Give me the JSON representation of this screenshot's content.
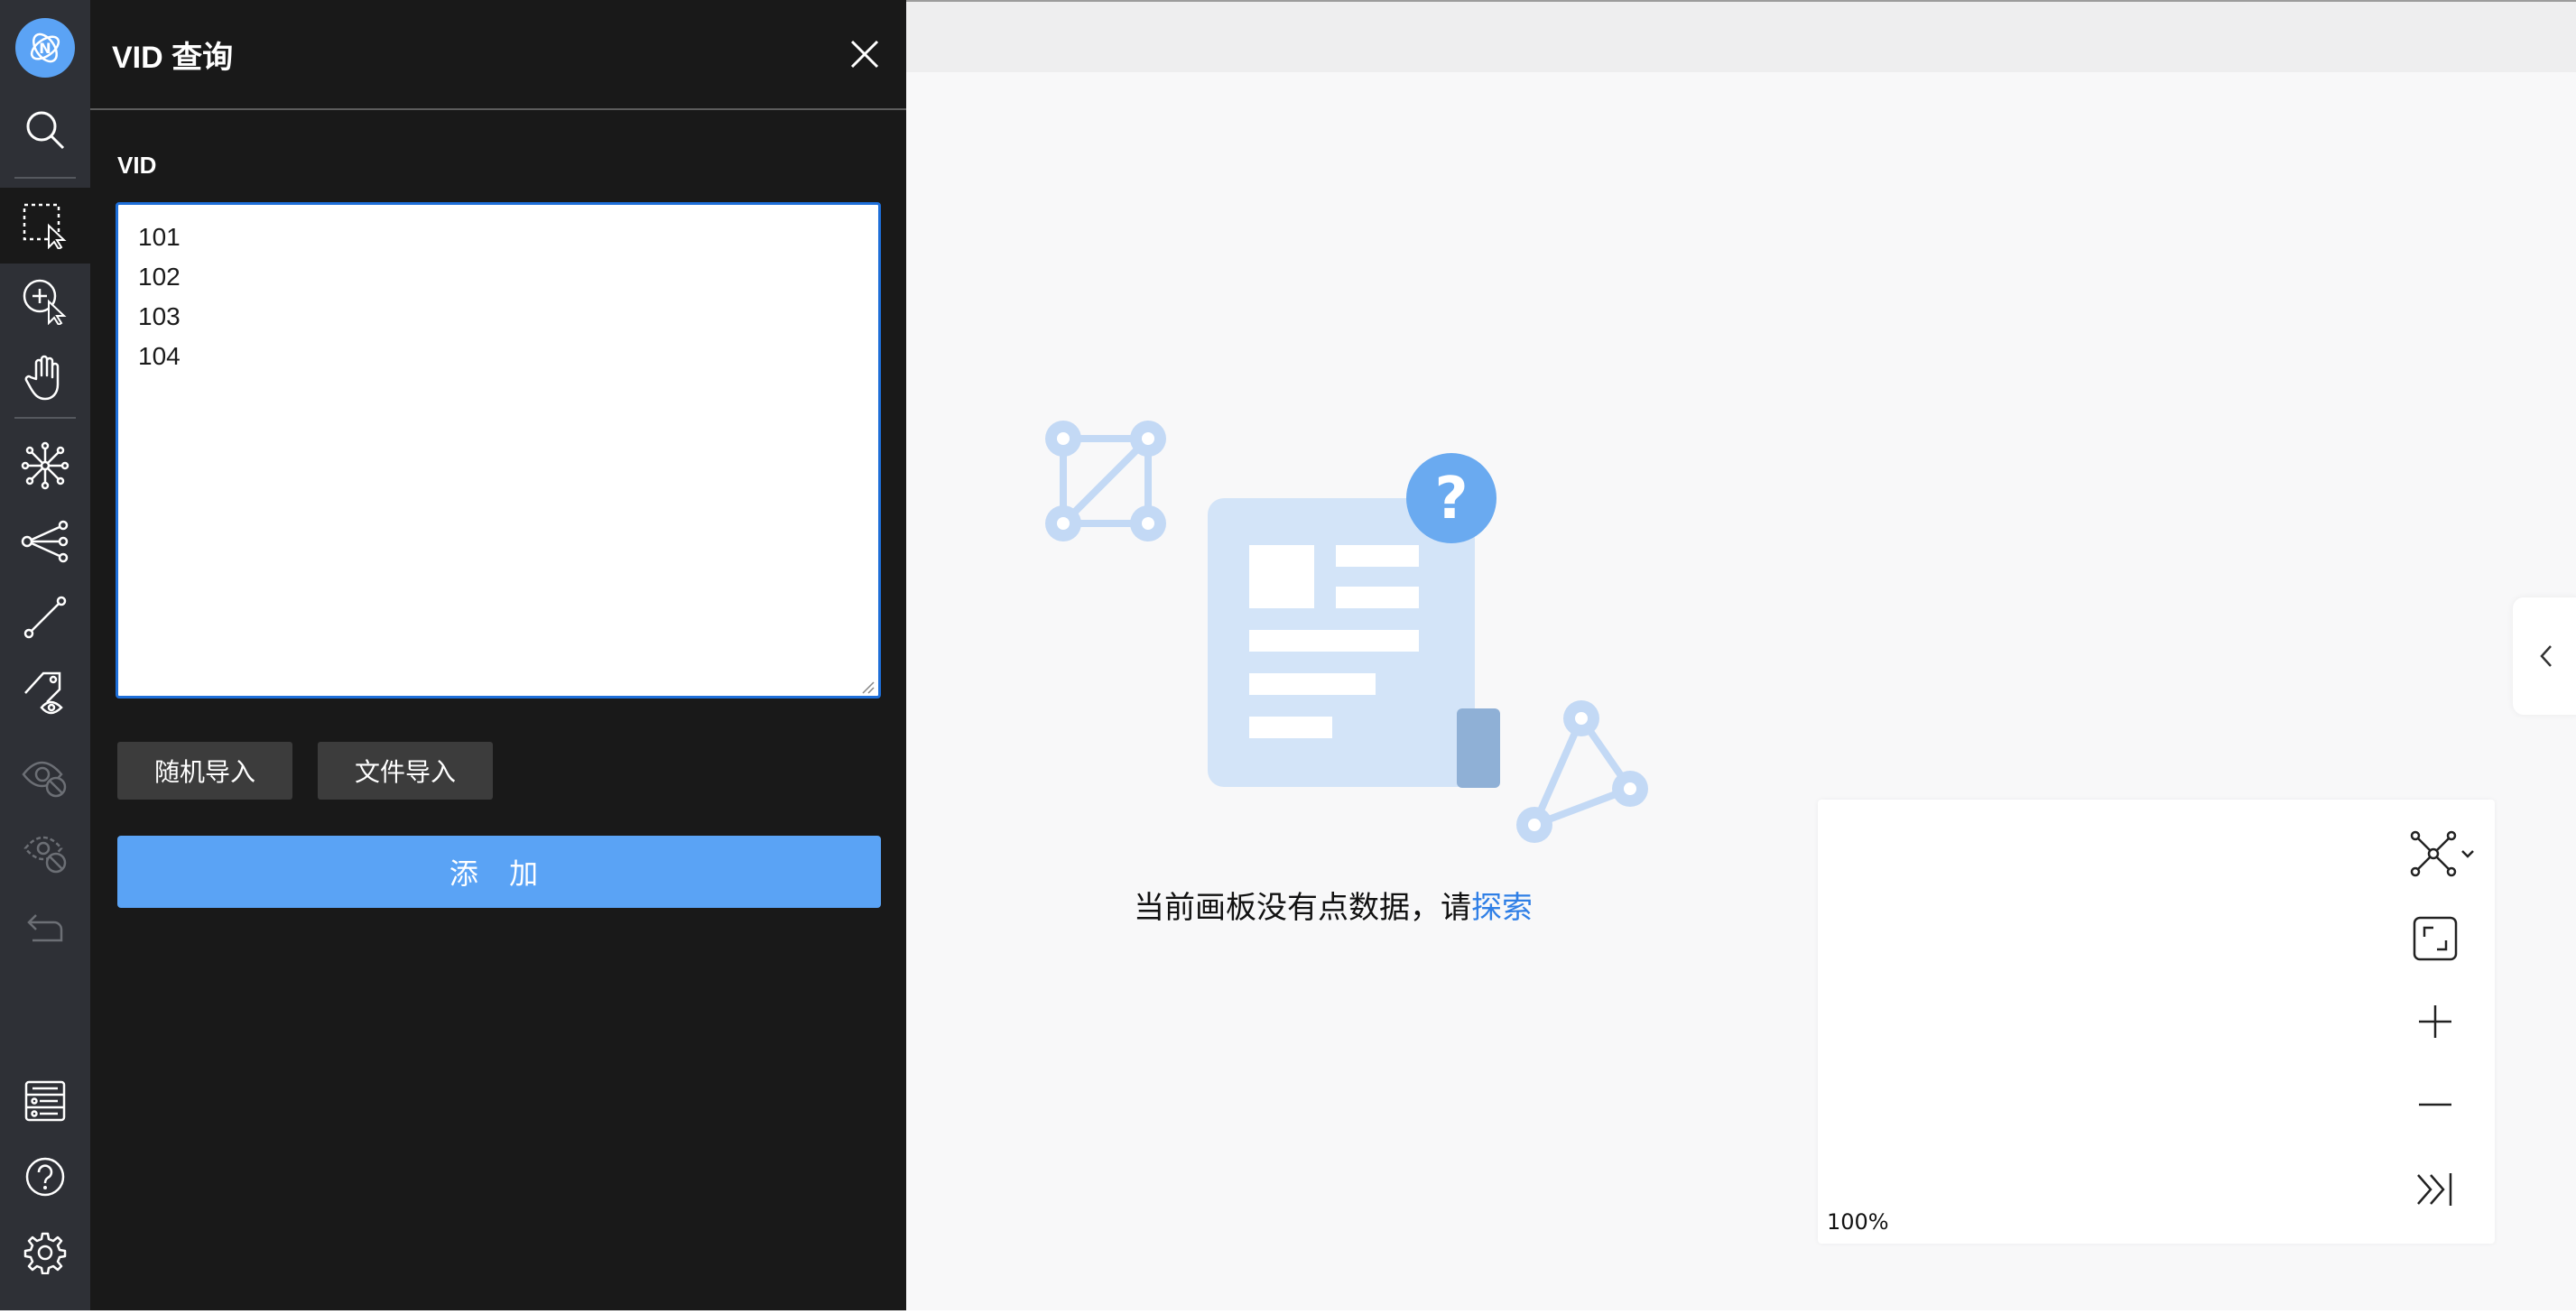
{
  "panel": {
    "title": "VID 查询",
    "field_label": "VID",
    "vid_values": "101\n102\n103\n104",
    "random_import_label": "随机导入",
    "file_import_label": "文件导入",
    "add_label": "添 加"
  },
  "toolbar": {
    "icons": [
      "logo-icon",
      "search-icon",
      "box-select-icon",
      "click-select-icon",
      "hand-pan-icon",
      "network-expand-icon",
      "share-nodes-icon",
      "path-icon",
      "tag-visibility-icon",
      "hide-icon",
      "hide-others-icon",
      "undo-icon",
      "list-settings-icon",
      "help-icon",
      "gear-icon"
    ]
  },
  "canvas": {
    "empty_message": "当前画板没有点数据，请",
    "explore_link": "探索",
    "zoom_level": "100%"
  },
  "colors": {
    "accent": "#5aa3f5",
    "link": "#2f7fe6",
    "panel_bg": "#191919",
    "toolbar_bg": "#2e3036"
  }
}
